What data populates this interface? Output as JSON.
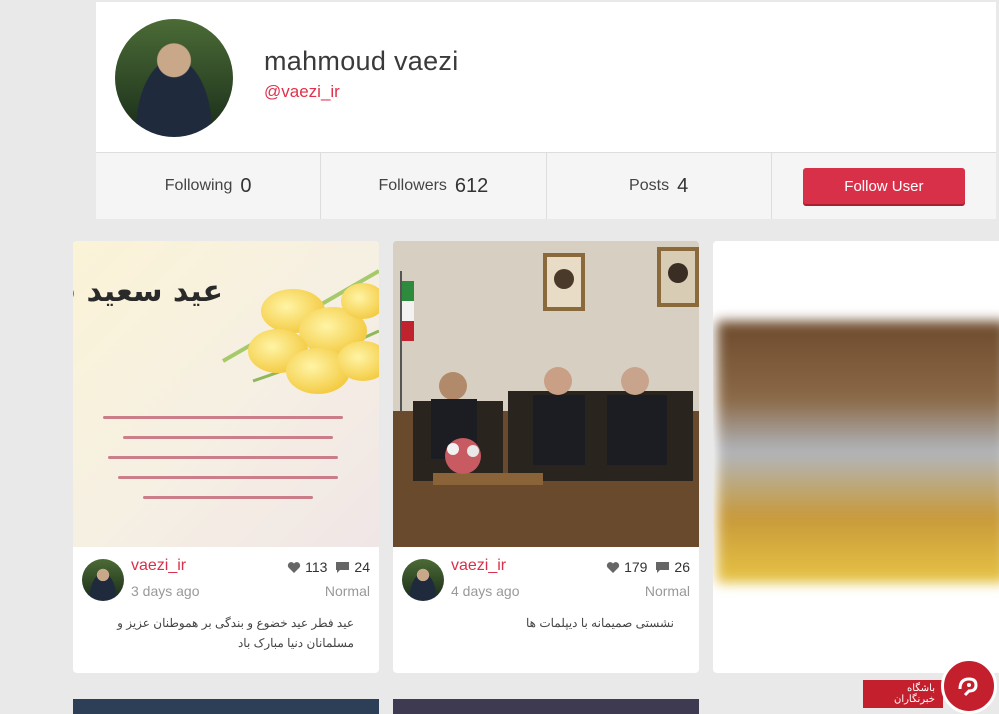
{
  "profile": {
    "name": "mahmoud vaezi",
    "handle": "@vaezi_ir",
    "stats": [
      {
        "label": "Following",
        "value": "0"
      },
      {
        "label": "Followers",
        "value": "612"
      },
      {
        "label": "Posts",
        "value": "4"
      }
    ],
    "follow_label": "Follow User"
  },
  "posts": [
    {
      "username": "vaezi_ir",
      "time": "3 days ago",
      "likes": "113",
      "comments": "24",
      "category": "Normal",
      "caption": "عید فطر عید خضوع و بندگی بر هموطنان عزیز و مسلمانان دنیا مبارک باد",
      "image_text": "عید سعید فطر مبارک"
    },
    {
      "username": "vaezi_ir",
      "time": "4 days ago",
      "likes": "179",
      "comments": "26",
      "category": "Normal",
      "caption": "نشستی صمیمانه با دیپلمات ها"
    }
  ],
  "watermark": {
    "text": "باشگاه خبرنگاران"
  },
  "colors": {
    "accent": "#d9304a",
    "background": "#e9e9e9"
  }
}
